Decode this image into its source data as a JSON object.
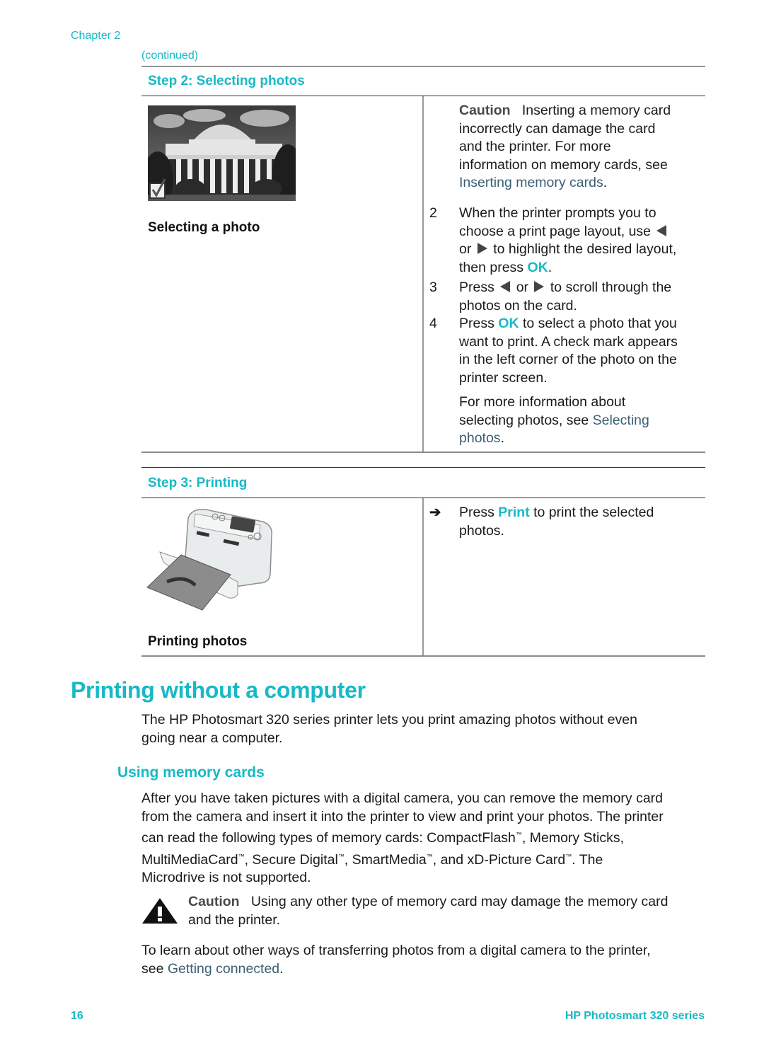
{
  "header": {
    "chapter": "Chapter 2",
    "continued": "(continued)"
  },
  "step2": {
    "title": "Step 2: Selecting photos",
    "image_caption": "Selecting a photo",
    "image_alt": "photo-of-domed-building-with-checkmark",
    "caution_label": "Caution",
    "caution_text_lines": [
      "Inserting a memory card",
      "incorrectly can damage the card",
      "and the printer. For more",
      "information on memory cards, see"
    ],
    "caution_link": "Inserting memory cards",
    "steps": [
      {
        "number": "2",
        "line1": "When the printer prompts you to",
        "line2a": "choose a print page layout, use",
        "line3a": "or",
        "line3b": "to highlight the desired layout,",
        "line4a": "then press",
        "ok": "OK",
        "line4b": "."
      },
      {
        "number": "3",
        "line1a": "Press",
        "line1b": "or",
        "line1c": "to scroll through the",
        "line2": "photos on the card."
      },
      {
        "number": "4",
        "line1a": "Press",
        "ok": "OK",
        "line1b": "to select a photo that you",
        "line2": "want to print. A check mark appears",
        "line3": "in the left corner of the photo on the",
        "line4": "printer screen."
      }
    ],
    "more_info_line1": "For more information about",
    "more_info_line2a": "selecting photos, see",
    "more_info_link_a": "Selecting",
    "more_info_link_b": "photos",
    "more_info_end": "."
  },
  "step3": {
    "title": "Step 3: Printing",
    "image_caption": "Printing photos",
    "image_alt": "photo-printer-printing-photo",
    "arrow": "➔",
    "text_a": "Press",
    "print": "Print",
    "text_b": "to print the selected",
    "text_c": "photos."
  },
  "section": {
    "title": "Printing without a computer",
    "intro_line1": "The HP Photosmart 320 series printer lets you print amazing photos without even",
    "intro_line2": "going near a computer.",
    "subsection_title": "Using memory cards",
    "para_lines": [
      "After you have taken pictures with a digital camera, you can remove the memory card",
      "from the camera and insert it into the printer to view and print your photos. The printer"
    ],
    "para_line3a": "can read the following types of memory cards: CompactFlash",
    "para_line3b": ", Memory Sticks,",
    "para_line4a": "MultiMediaCard",
    "para_line4b": ", Secure Digital",
    "para_line4c": ", SmartMedia",
    "para_line4d": ", and xD-Picture Card",
    "para_line4e": ". The",
    "para_line5": "Microdrive is not supported.",
    "tm": "™",
    "caution_label": "Caution",
    "caution_line1": "Using any other type of memory card may damage the memory card",
    "caution_line2": "and the printer.",
    "transfer_line1": "To learn about other ways of transferring photos from a digital camera to the printer,",
    "transfer_line2a": "see",
    "transfer_link": "Getting connected",
    "transfer_end": "."
  },
  "footer": {
    "page_number": "16",
    "product": "HP Photosmart 320 series"
  },
  "colors": {
    "accent": "#17b9c4",
    "link": "#3b5f73",
    "text": "#1a1a1a"
  }
}
